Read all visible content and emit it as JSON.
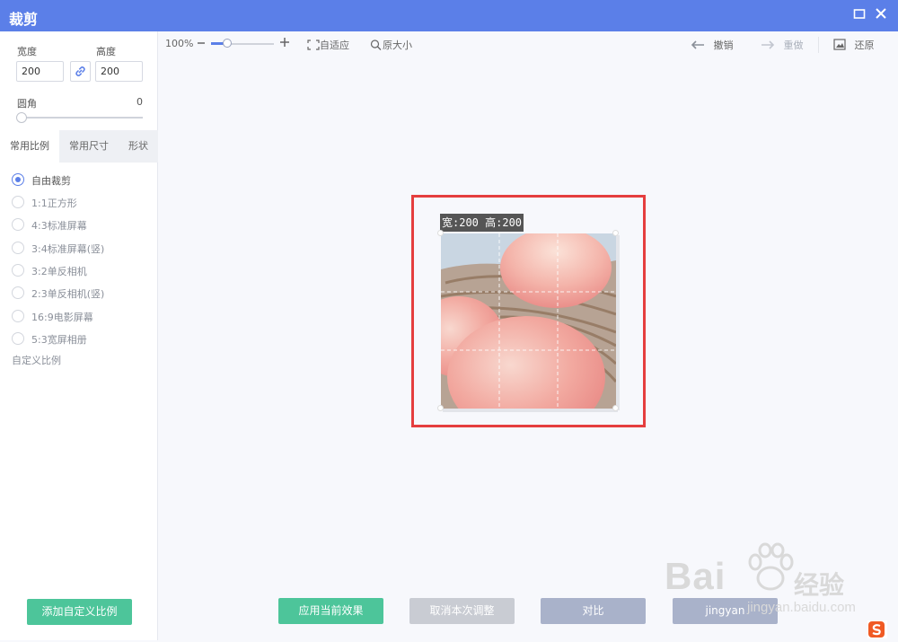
{
  "window": {
    "title": "裁剪",
    "maximize_icon": "maximize-icon",
    "close_icon": "close-icon"
  },
  "sidebar": {
    "width_label": "宽度",
    "height_label": "高度",
    "width_value": "200",
    "height_value": "200",
    "link_icon": "link-icon",
    "corner_label": "圆角",
    "corner_value": "0",
    "tabs": [
      "常用比例",
      "常用尺寸",
      "形状"
    ],
    "ratios": [
      "自由裁剪",
      "1:1正方形",
      "4:3标准屏幕",
      "3:4标准屏幕(竖)",
      "3:2单反相机",
      "2:3单反相机(竖)",
      "16:9电影屏幕",
      "5:3宽屏相册"
    ],
    "selected_ratio": "自由裁剪",
    "custom_ratio_label": "自定义比例",
    "add_custom_button": "添加自定义比例"
  },
  "toolbar": {
    "zoom": "100%",
    "zoom_out_icon": "minus-icon",
    "zoom_in_icon": "plus-icon",
    "fit_label": "自适应",
    "original_label": "原大小",
    "undo_label": "撤销",
    "redo_label": "重做",
    "restore_label": "还原"
  },
  "canvas": {
    "dimension_label": "宽:200 高:200",
    "accent": "#e53e3e"
  },
  "footer": {
    "apply_button": "应用当前效果",
    "cancel_button": "取消本次调整",
    "compare_button": "对比",
    "fourth_button": "jingyan"
  },
  "watermark": {
    "brand": "Bai",
    "brand_tail": "经验",
    "url": "jingyan.baidu.com"
  },
  "colors": {
    "accent": "#5b7fe8",
    "green": "#4dc59a",
    "titlebar": "#5b7fe8"
  }
}
